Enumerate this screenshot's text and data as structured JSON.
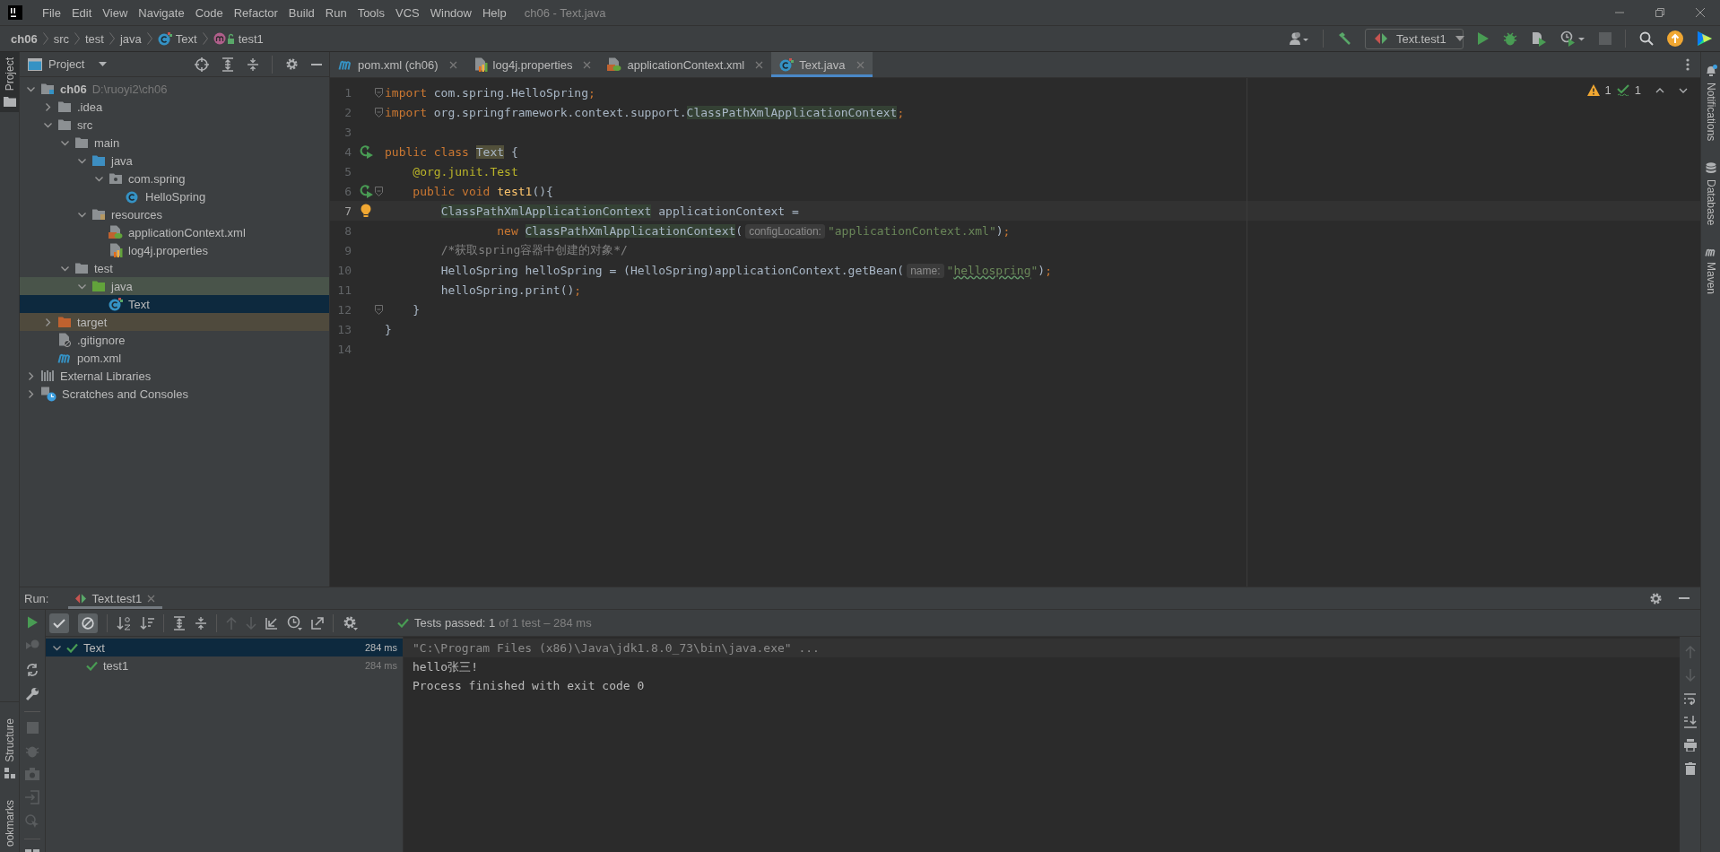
{
  "window": {
    "title": "ch06 - Text.java",
    "menu": [
      "File",
      "Edit",
      "View",
      "Navigate",
      "Code",
      "Refactor",
      "Build",
      "Run",
      "Tools",
      "VCS",
      "Window",
      "Help"
    ]
  },
  "breadcrumb": [
    {
      "label": "ch06",
      "kind": "project"
    },
    {
      "label": "src",
      "kind": "folder"
    },
    {
      "label": "test",
      "kind": "folder"
    },
    {
      "label": "java",
      "kind": "folder"
    },
    {
      "label": "Text",
      "kind": "test-class"
    },
    {
      "label": "test1",
      "kind": "method"
    }
  ],
  "run_config": {
    "label": "Text.test1"
  },
  "tool_windows": {
    "left_top": [
      {
        "label": "Project",
        "selected": true
      }
    ],
    "left_bottom": [
      {
        "label": "Structure",
        "selected": false
      },
      {
        "label": "ookmarks",
        "selected": false
      }
    ],
    "right": [
      {
        "label": "Notifications",
        "kind": "bell",
        "selected": false
      },
      {
        "label": "Database",
        "kind": "database",
        "selected": false
      },
      {
        "label": "Maven",
        "kind": "maven",
        "selected": false
      }
    ]
  },
  "project_panel": {
    "title": "Project",
    "tree": [
      {
        "label": "ch06",
        "hint": "D:\\ruoyi2\\ch06",
        "kind": "module",
        "expanded": true,
        "selected": false,
        "children": [
          {
            "label": ".idea",
            "kind": "folder",
            "expanded": false,
            "selected": false
          },
          {
            "label": "src",
            "kind": "folder",
            "expanded": true,
            "selected": false,
            "children": [
              {
                "label": "main",
                "kind": "folder",
                "expanded": true,
                "selected": false,
                "children": [
                  {
                    "label": "java",
                    "kind": "source-root",
                    "expanded": true,
                    "selected": false,
                    "children": [
                      {
                        "label": "com.spring",
                        "kind": "package",
                        "expanded": true,
                        "selected": false,
                        "children": [
                          {
                            "label": "HelloSpring",
                            "kind": "class",
                            "selected": false
                          }
                        ]
                      }
                    ]
                  },
                  {
                    "label": "resources",
                    "kind": "resources",
                    "expanded": true,
                    "selected": false,
                    "children": [
                      {
                        "label": "applicationContext.xml",
                        "kind": "xml",
                        "selected": false
                      },
                      {
                        "label": "log4j.properties",
                        "kind": "properties",
                        "selected": false
                      }
                    ]
                  }
                ]
              },
              {
                "label": "test",
                "kind": "folder",
                "expanded": true,
                "selected": false,
                "children": [
                  {
                    "label": "java",
                    "kind": "test-root",
                    "expanded": true,
                    "selected": false,
                    "children": [
                      {
                        "label": "Text",
                        "kind": "test-class",
                        "selected": true
                      }
                    ]
                  }
                ]
              }
            ]
          },
          {
            "label": "target",
            "kind": "excluded",
            "expanded": false,
            "selected": false
          },
          {
            "label": ".gitignore",
            "kind": "gitignore",
            "selected": false
          },
          {
            "label": "pom.xml",
            "kind": "maven",
            "selected": false
          }
        ]
      },
      {
        "label": "External Libraries",
        "kind": "libraries",
        "expanded": false,
        "selected": false
      },
      {
        "label": "Scratches and Consoles",
        "kind": "scratches",
        "expanded": false,
        "selected": false
      }
    ]
  },
  "editor": {
    "tabs": [
      {
        "label": "pom.xml (ch06)",
        "kind": "maven",
        "selected": false
      },
      {
        "label": "log4j.properties",
        "kind": "properties",
        "selected": false
      },
      {
        "label": "applicationContext.xml",
        "kind": "xml",
        "selected": false
      },
      {
        "label": "Text.java",
        "kind": "test-class",
        "selected": true
      }
    ],
    "inspections": {
      "warnings": "1",
      "weak_warnings": "1"
    },
    "lines": [
      {
        "number": "1",
        "fold": true,
        "kind": "none",
        "current": false,
        "tokens": [
          {
            "text": "import ",
            "kind": "keyword"
          },
          {
            "text": "com.spring.HelloSpring",
            "kind": "plain"
          },
          {
            "text": ";",
            "kind": "keyword"
          }
        ]
      },
      {
        "number": "2",
        "fold": true,
        "kind": "none",
        "current": false,
        "tokens": [
          {
            "text": "import ",
            "kind": "keyword"
          },
          {
            "text": "org.springframework.context.support.",
            "kind": "plain"
          },
          {
            "text": "ClassPathXmlApplicationContext",
            "kind": "highlight"
          },
          {
            "text": ";",
            "kind": "keyword"
          }
        ]
      },
      {
        "number": "3",
        "fold": false,
        "kind": "none",
        "current": false
      },
      {
        "number": "4",
        "fold": false,
        "kind": "run",
        "current": false,
        "tokens": [
          {
            "text": "public class ",
            "kind": "keyword"
          },
          {
            "text": "Text",
            "kind": "usage"
          },
          {
            "text": " {",
            "kind": "plain"
          }
        ]
      },
      {
        "number": "5",
        "fold": false,
        "kind": "none",
        "current": false,
        "tokens": [
          {
            "text": "    @org.junit.Test",
            "kind": "annotation"
          }
        ]
      },
      {
        "number": "6",
        "fold": true,
        "kind": "run",
        "current": false,
        "tokens": [
          {
            "text": "    public void ",
            "kind": "keyword"
          },
          {
            "text": "test1",
            "kind": "method"
          },
          {
            "text": "(){",
            "kind": "plain"
          }
        ]
      },
      {
        "number": "7",
        "fold": false,
        "kind": "bulb",
        "current": true,
        "tokens": [
          {
            "text": "        ClassPathXmlApplicationContext",
            "kind": "highlight"
          },
          {
            "text": " applicationContext = ",
            "kind": "plain"
          }
        ]
      },
      {
        "number": "8",
        "fold": false,
        "kind": "none",
        "current": false,
        "tokens": [
          {
            "text": "                new ",
            "kind": "keyword"
          },
          {
            "text": "ClassPathXmlApplicationContext",
            "kind": "highlight"
          },
          {
            "text": "(",
            "kind": "plain"
          },
          {
            "text": "configLocation:",
            "kind": "hint"
          },
          {
            "text": "\"applicationContext.xml\"",
            "kind": "string"
          },
          {
            "text": ")",
            "kind": "plain"
          },
          {
            "text": ";",
            "kind": "keyword"
          }
        ]
      },
      {
        "number": "9",
        "fold": false,
        "kind": "none",
        "current": false,
        "tokens": [
          {
            "text": "        /*获取spring容器中创建的对象*/",
            "kind": "comment"
          }
        ]
      },
      {
        "number": "10",
        "fold": false,
        "kind": "none",
        "current": false,
        "tokens": [
          {
            "text": "        HelloSpring helloSpring = (HelloSpring)applicationContext.getBean(",
            "kind": "plain"
          },
          {
            "text": "name:",
            "kind": "hint"
          },
          {
            "text": "\"",
            "kind": "string"
          },
          {
            "text": "hellospring",
            "kind": "typo"
          },
          {
            "text": "\"",
            "kind": "string"
          },
          {
            "text": ")",
            "kind": "plain"
          },
          {
            "text": ";",
            "kind": "keyword"
          }
        ]
      },
      {
        "number": "11",
        "fold": false,
        "kind": "none",
        "current": false,
        "tokens": [
          {
            "text": "        helloSpring.print()",
            "kind": "plain"
          },
          {
            "text": ";",
            "kind": "keyword"
          }
        ]
      },
      {
        "number": "12",
        "fold": true,
        "kind": "none",
        "current": false,
        "tokens": [
          {
            "text": "    }",
            "kind": "plain"
          }
        ]
      },
      {
        "number": "13",
        "fold": false,
        "kind": "none",
        "current": false,
        "tokens": [
          {
            "text": "}",
            "kind": "plain"
          }
        ]
      },
      {
        "number": "14",
        "fold": false,
        "kind": "none",
        "current": false
      }
    ]
  },
  "run_panel": {
    "label": "Run:",
    "tab": {
      "label": "Text.test1",
      "selected": true
    },
    "filters": [
      {
        "kind": "passed",
        "on": true
      },
      {
        "kind": "ignored",
        "on": true
      }
    ],
    "status": {
      "summary": "Tests passed: 1",
      "detail": "of 1 test – 284 ms"
    },
    "tests": [
      {
        "label": "Text",
        "time": "284 ms",
        "passed": true,
        "expanded": true,
        "selected": true,
        "children": [
          {
            "label": "test1",
            "time": "284 ms",
            "passed": true,
            "selected": false
          }
        ]
      }
    ],
    "console": [
      {
        "text": "\"C:\\Program Files (x86)\\Java\\jdk1.8.0_73\\bin\\java.exe\" ...",
        "kind": "command"
      },
      {
        "text": "hello张三!",
        "kind": "output"
      },
      {
        "text": "Process finished with exit code 0",
        "kind": "output"
      }
    ]
  }
}
